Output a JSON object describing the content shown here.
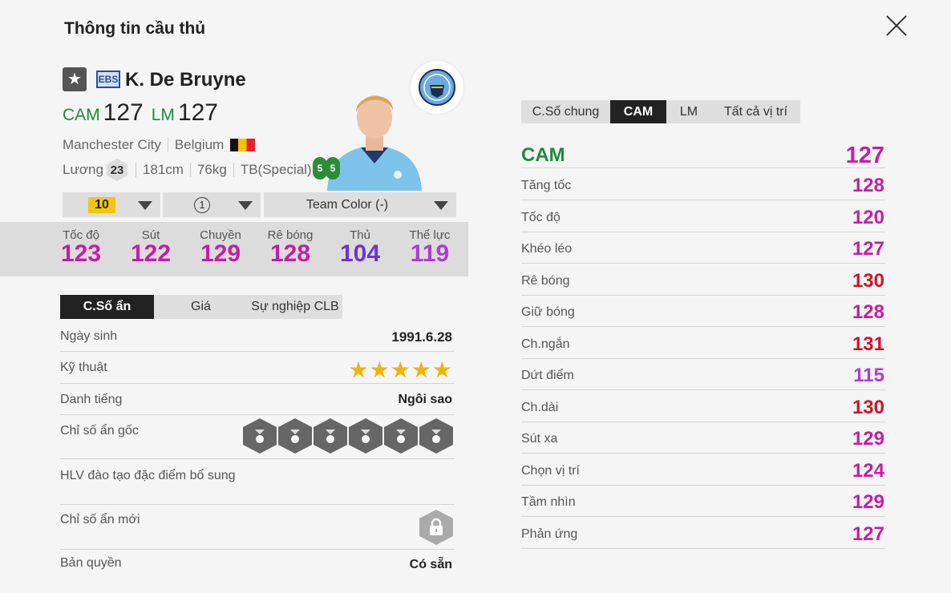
{
  "header": {
    "title": "Thông tin cầu thủ"
  },
  "player": {
    "season_badge": "EBS",
    "name": "K. De Bruyne",
    "pos1": "CAM",
    "ovr1": "127",
    "pos2": "LM",
    "ovr2": "127",
    "club": "Manchester City",
    "nation": "Belgium",
    "salary_label": "Lương",
    "salary": "23",
    "height": "181cm",
    "weight": "76kg",
    "body_type": "TB(Special)",
    "foot_left": "5",
    "foot_right": "5"
  },
  "selectors": {
    "level": "10",
    "slot": "1",
    "team_color": "Team Color (-)"
  },
  "summary_stats": [
    {
      "label": "Tốc độ",
      "value": "123",
      "color": "#c21fa4"
    },
    {
      "label": "Sút",
      "value": "122",
      "color": "#c21fa4"
    },
    {
      "label": "Chuyền",
      "value": "129",
      "color": "#c21fa4"
    },
    {
      "label": "Rê bóng",
      "value": "128",
      "color": "#c21fa4"
    },
    {
      "label": "Thủ",
      "value": "104",
      "color": "#6a35d6"
    },
    {
      "label": "Thể lực",
      "value": "119",
      "color": "#b13ad6"
    }
  ],
  "left_tabs": [
    "C.Số ẩn",
    "Giá",
    "Sự nghiệp CLB"
  ],
  "info": {
    "birth_label": "Ngày sinh",
    "birth": "1991.6.28",
    "skill_label": "Kỹ thuật",
    "skill_stars": 5,
    "rep_label": "Danh tiếng",
    "rep": "Ngôi sao",
    "traits_label": "Chỉ số ẩn gốc",
    "coach_label": "HLV đào tạo đặc điểm bổ sung",
    "new_traits_label": "Chỉ số ẩn mới",
    "license_label": "Bản quyền",
    "license": "Có sẵn"
  },
  "trait_icons": [
    "swerve-pass-icon",
    "finesse-shot-icon",
    "power-header-icon",
    "playmaker-icon",
    "long-shot-icon",
    "outside-foot-icon"
  ],
  "right_tabs": [
    "C.Số chung",
    "CAM",
    "LM",
    "Tất cả vị trí"
  ],
  "position_rating": {
    "label": "CAM",
    "value": "127"
  },
  "attributes": [
    {
      "label": "Tăng tốc",
      "value": "128",
      "color": "#c21fa4"
    },
    {
      "label": "Tốc độ",
      "value": "120",
      "color": "#c21fa4"
    },
    {
      "label": "Khéo léo",
      "value": "127",
      "color": "#c21fa4"
    },
    {
      "label": "Rê bóng",
      "value": "130",
      "color": "#d4122b"
    },
    {
      "label": "Giữ bóng",
      "value": "128",
      "color": "#c21fa4"
    },
    {
      "label": "Ch.ngắn",
      "value": "131",
      "color": "#d4122b"
    },
    {
      "label": "Dứt điểm",
      "value": "115",
      "color": "#b13ad6"
    },
    {
      "label": "Ch.dài",
      "value": "130",
      "color": "#d4122b"
    },
    {
      "label": "Sút xa",
      "value": "129",
      "color": "#c21fa4"
    },
    {
      "label": "Chọn vị trí",
      "value": "124",
      "color": "#c21fa4"
    },
    {
      "label": "Tầm nhìn",
      "value": "129",
      "color": "#c21fa4"
    },
    {
      "label": "Phản ứng",
      "value": "127",
      "color": "#c21fa4"
    }
  ]
}
